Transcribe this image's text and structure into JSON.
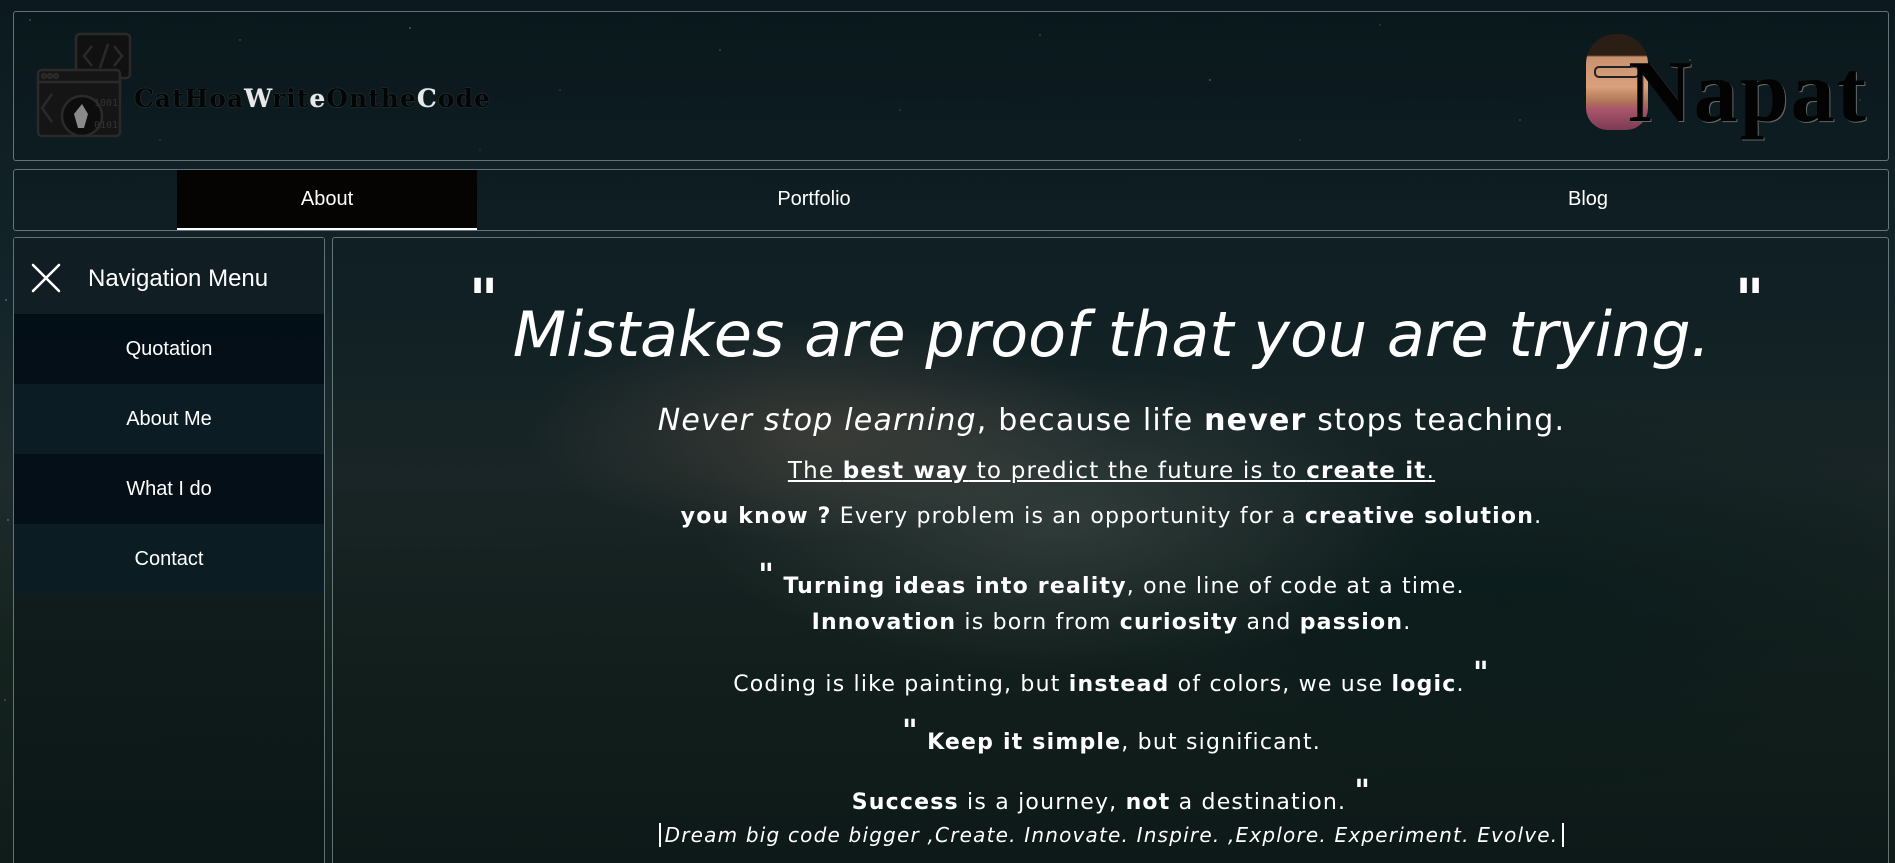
{
  "header": {
    "logo_text_parts": [
      "Ca",
      "t",
      "Ho",
      "a",
      "W",
      "ri",
      "t",
      "e",
      "O",
      "n",
      "t",
      "h",
      "e",
      "C",
      "o",
      "d",
      "e"
    ],
    "logo_text": "CatHowWriteOntheCode",
    "brand": "Napat",
    "logo_icon": "code-window-icon",
    "avatar_icon": "profile-photo"
  },
  "tabs": [
    {
      "label": "About",
      "active": true
    },
    {
      "label": "Portfolio",
      "active": false
    },
    {
      "label": "Blog",
      "active": false
    }
  ],
  "sidebar": {
    "title": "Navigation Menu",
    "close_icon": "close-icon",
    "items": [
      {
        "label": "Quotation"
      },
      {
        "label": "About Me"
      },
      {
        "label": "What I do"
      },
      {
        "label": "Contact"
      }
    ]
  },
  "main": {
    "quote_mark": "\"",
    "headline": "Mistakes are proof that you are trying.",
    "lines": {
      "l1_em": "Never stop learning",
      "l1_mid": ", because life ",
      "l1_b": "never",
      "l1_end": " stops teaching.",
      "l2_a": "The ",
      "l2_b": "best way",
      "l2_c": " to predict the future is to ",
      "l2_d": "create it",
      "l2_e": ".",
      "l3_b": "you know ?",
      "l3_mid": " Every problem is an opportunity for a ",
      "l3_b2": "creative solution",
      "l3_end": ".",
      "l4_b": "Turning ideas into reality",
      "l4_end": ", one line of code at a time.",
      "l5_b1": "Innovation",
      "l5_m1": " is born from ",
      "l5_b2": "curiosity",
      "l5_m2": " and ",
      "l5_b3": "passion",
      "l5_end": ".",
      "l6_a": "Coding is like painting, but ",
      "l6_b1": "instead",
      "l6_m": " of colors, we use ",
      "l6_b2": "logic",
      "l6_end": ".",
      "l7_b": "Keep it simple",
      "l7_end": ", but significant.",
      "l8_b1": "Success",
      "l8_m": " is a journey, ",
      "l8_b2": "not",
      "l8_end": " a destination.",
      "typed": "Dream big code bigger ,Create. Innovate. Inspire. ,Explore. Experiment. Evolve."
    }
  },
  "colors": {
    "background": "#13252a",
    "panel_border": "#aabebe",
    "active_tab_bg": "#050403",
    "sidebar_dark": "#020e16",
    "text": "#ffffff"
  }
}
